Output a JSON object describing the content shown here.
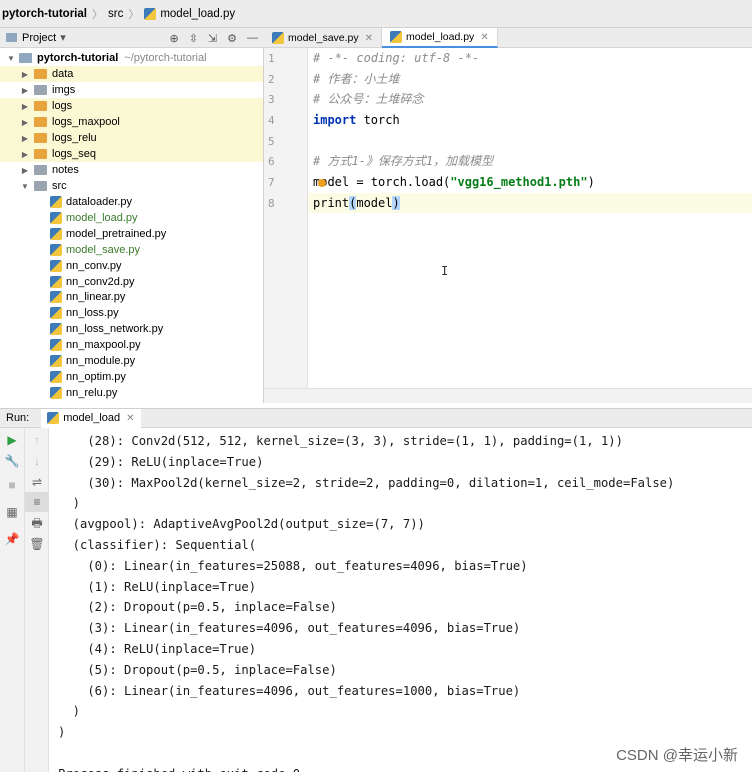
{
  "breadcrumb": {
    "project": "pytorch-tutorial",
    "folder": "src",
    "file": "model_load.py"
  },
  "project_panel": {
    "title": "Project",
    "dropdown": "▾",
    "root": {
      "name": "pytorch-tutorial",
      "path": "~/pytorch-tutorial"
    },
    "folders": [
      {
        "name": "data",
        "highlighted": true
      },
      {
        "name": "imgs",
        "highlighted": false
      },
      {
        "name": "logs",
        "highlighted": true
      },
      {
        "name": "logs_maxpool",
        "highlighted": true
      },
      {
        "name": "logs_relu",
        "highlighted": true
      },
      {
        "name": "logs_seq",
        "highlighted": true
      },
      {
        "name": "notes",
        "highlighted": false
      },
      {
        "name": "src",
        "highlighted": false
      }
    ],
    "files": [
      {
        "name": "dataloader.py",
        "vcs": "normal"
      },
      {
        "name": "model_load.py",
        "vcs": "added"
      },
      {
        "name": "model_pretrained.py",
        "vcs": "normal"
      },
      {
        "name": "model_save.py",
        "vcs": "added"
      },
      {
        "name": "nn_conv.py",
        "vcs": "normal"
      },
      {
        "name": "nn_conv2d.py",
        "vcs": "normal"
      },
      {
        "name": "nn_linear.py",
        "vcs": "normal"
      },
      {
        "name": "nn_loss.py",
        "vcs": "normal"
      },
      {
        "name": "nn_loss_network.py",
        "vcs": "normal"
      },
      {
        "name": "nn_maxpool.py",
        "vcs": "normal"
      },
      {
        "name": "nn_module.py",
        "vcs": "normal"
      },
      {
        "name": "nn_optim.py",
        "vcs": "normal"
      },
      {
        "name": "nn_relu.py",
        "vcs": "normal"
      }
    ]
  },
  "editor": {
    "tabs": [
      {
        "label": "model_save.py",
        "active": false
      },
      {
        "label": "model_load.py",
        "active": true
      }
    ],
    "line_numbers": [
      "1",
      "2",
      "3",
      "4",
      "5",
      "6",
      "7",
      "8"
    ],
    "lines": {
      "l1": "# -*- coding: utf-8 -*-",
      "l2": "# 作者：小土堆",
      "l3": "# 公众号：土堆碎念",
      "l4_kw": "import",
      "l4_rest": " torch",
      "l6": "# 方式1-》保存方式1，加载模型",
      "l7_a": "model = torch.load(",
      "l7_str": "\"vgg16_method1.pth\"",
      "l7_b": ")",
      "l8_a": "print",
      "l8_p1": "(",
      "l8_mid": "model",
      "l8_p2": ")"
    },
    "current_line": "8"
  },
  "run_panel": {
    "label": "Run:",
    "tab": "model_load",
    "console": [
      "    (28): Conv2d(512, 512, kernel_size=(3, 3), stride=(1, 1), padding=(1, 1))",
      "    (29): ReLU(inplace=True)",
      "    (30): MaxPool2d(kernel_size=2, stride=2, padding=0, dilation=1, ceil_mode=False)",
      "  )",
      "  (avgpool): AdaptiveAvgPool2d(output_size=(7, 7))",
      "  (classifier): Sequential(",
      "    (0): Linear(in_features=25088, out_features=4096, bias=True)",
      "    (1): ReLU(inplace=True)",
      "    (2): Dropout(p=0.5, inplace=False)",
      "    (3): Linear(in_features=4096, out_features=4096, bias=True)",
      "    (4): ReLU(inplace=True)",
      "    (5): Dropout(p=0.5, inplace=False)",
      "    (6): Linear(in_features=4096, out_features=1000, bias=True)",
      "  )",
      ")",
      "",
      "Process finished with exit code 0"
    ]
  },
  "watermark": "CSDN @幸运小新",
  "icons": {
    "globe": "target-icon",
    "expand": "expand-all-icon",
    "collapse": "collapse-all-icon",
    "gear": "gear-icon",
    "minimize": "minimize-icon"
  },
  "colors": {
    "highlight_row": "#fbf8d4",
    "added_file": "#3a7a2a",
    "keyword": "#0033b3",
    "string": "#067d17",
    "tab_underline": "#4a8fe0"
  }
}
